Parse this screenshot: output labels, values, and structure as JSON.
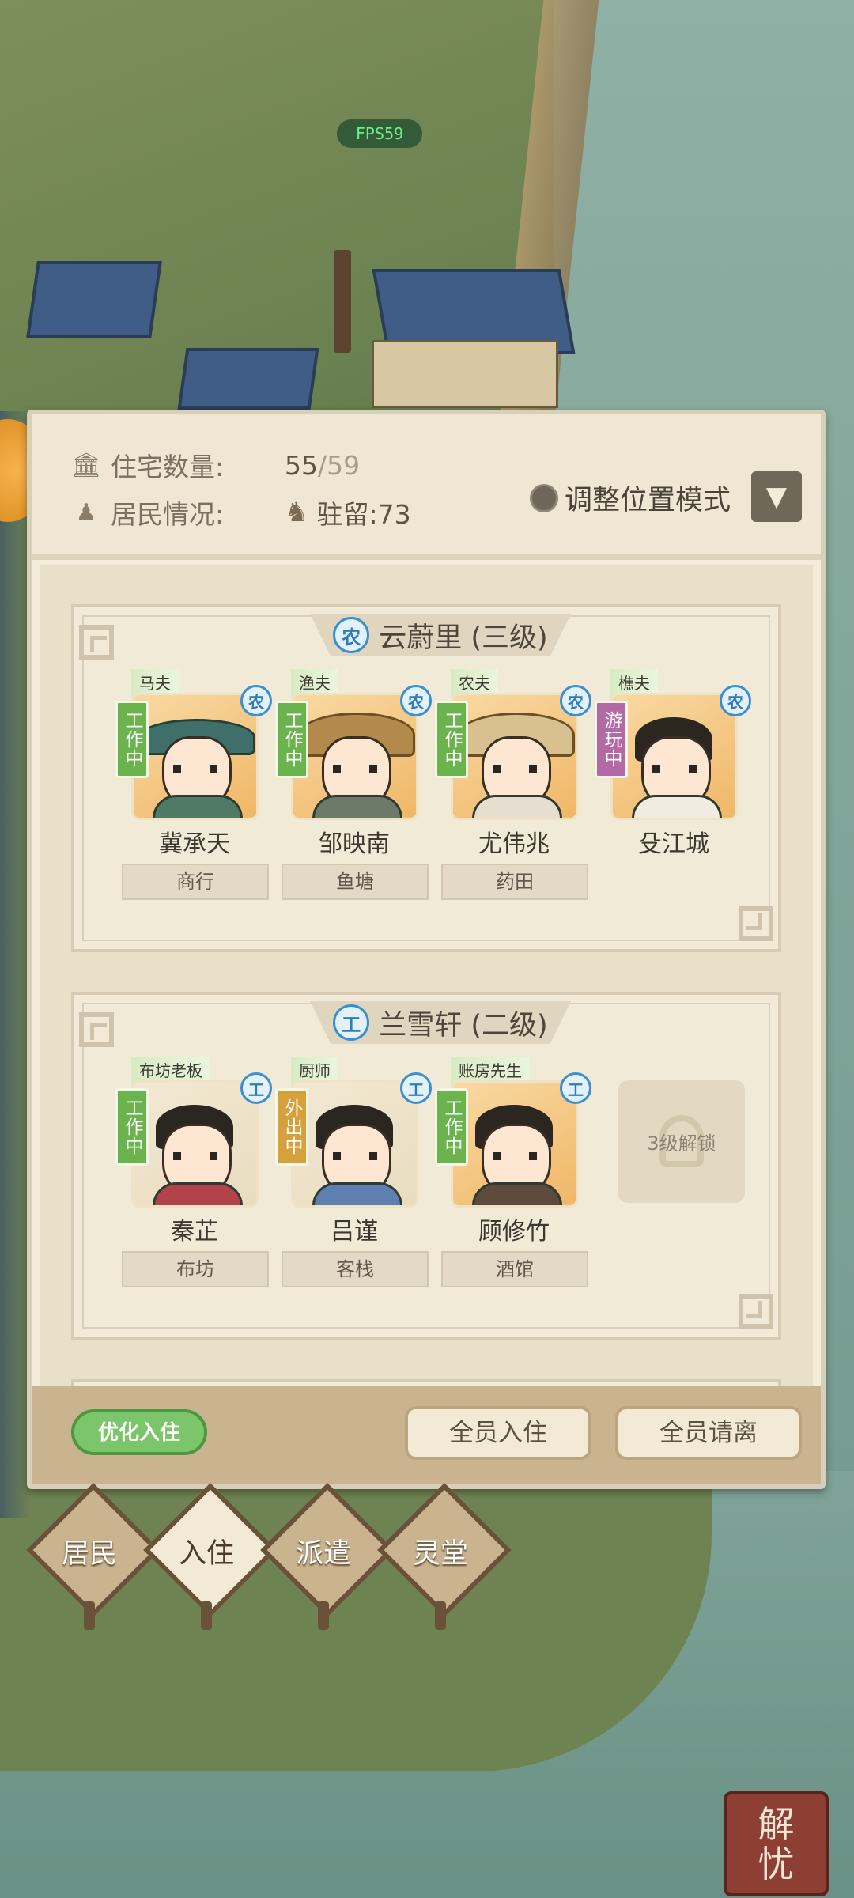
{
  "fps": "FPS59",
  "header": {
    "housing_label": "住宅数量:",
    "housing_current": "55",
    "housing_total": "/59",
    "resident_label": "居民情况:",
    "stationed": "驻留:73",
    "adjust_mode": "调整位置模式"
  },
  "houses": [
    {
      "title": "云蔚里 (三级)",
      "type": "农",
      "residents": [
        {
          "role": "马夫",
          "status": "工作中",
          "badge": "农",
          "name": "冀承天",
          "work": "商行"
        },
        {
          "role": "渔夫",
          "status": "工作中",
          "badge": "农",
          "name": "邹映南",
          "work": "鱼塘"
        },
        {
          "role": "农夫",
          "status": "工作中",
          "badge": "农",
          "name": "尤伟兆",
          "work": "药田"
        },
        {
          "role": "樵夫",
          "status": "游玩中",
          "badge": "农",
          "name": "殳江城",
          "work": ""
        }
      ]
    },
    {
      "title": "兰雪轩 (二级)",
      "type": "工",
      "residents": [
        {
          "role": "布坊老板",
          "status": "工作中",
          "badge": "工",
          "name": "秦芷",
          "work": "布坊"
        },
        {
          "role": "厨师",
          "status": "外出中",
          "badge": "工",
          "name": "吕谨",
          "work": "客栈"
        },
        {
          "role": "账房先生",
          "status": "工作中",
          "badge": "工",
          "name": "顾修竹",
          "work": "酒馆"
        }
      ],
      "locked_label": "3级解锁"
    }
  ],
  "footer": {
    "optimize": "优化入住",
    "all_move_in": "全员入住",
    "all_leave": "全员请离"
  },
  "tabs": [
    "居民",
    "入住",
    "派遣",
    "灵堂"
  ],
  "active_tab": "入住",
  "stamp_top": "解",
  "stamp_bottom": "忧",
  "colors": {
    "working": "#6ab34d",
    "playing": "#b36aa4",
    "out": "#d6a13a",
    "panel": "#f3ecd9",
    "accent_green": "#7bc66a"
  }
}
